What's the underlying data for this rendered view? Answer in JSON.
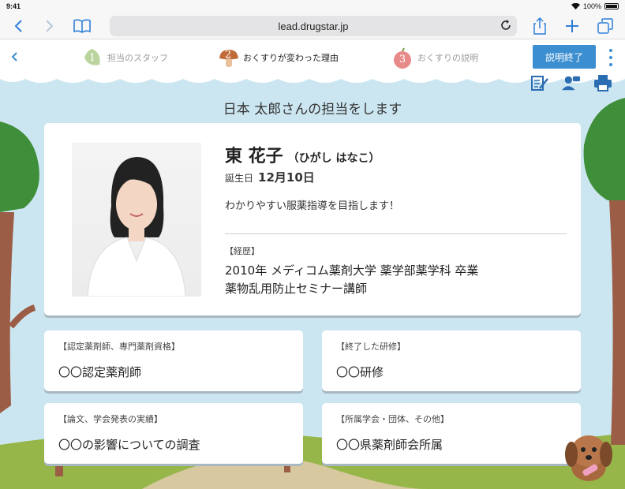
{
  "status": {
    "time": "9:41",
    "battery": "100%"
  },
  "browser": {
    "url": "lead.drugstar.jp"
  },
  "steps": [
    {
      "num": "1",
      "label": "担当のスタッフ"
    },
    {
      "num": "2",
      "label": "おくすりが変わった理由"
    },
    {
      "num": "3",
      "label": "おくすりの説明"
    }
  ],
  "end_button": "説明終了",
  "heading": "日本 太郎さんの担当をします",
  "profile": {
    "name": "東 花子",
    "kana": "（ひがし はなこ）",
    "birthday_label": "誕生日",
    "birthday": "12月10日",
    "message": "わかりやすい服薬指導を目指します！",
    "career_label": "【経歴】",
    "career_line1": "2010年 メディコム薬剤大学 薬学部薬学科 卒業",
    "career_line2": "薬物乱用防止セミナー講師"
  },
  "cards": [
    {
      "label": "【認定薬剤師、専門薬剤資格】",
      "value": "〇〇認定薬剤師"
    },
    {
      "label": "【終了した研修】",
      "value": "〇〇研修"
    },
    {
      "label": "【論文、学会発表の実績】",
      "value": "〇〇の影響についての調査"
    },
    {
      "label": "【所属学会・団体、その他】",
      "value": "〇〇県薬剤師会所属"
    }
  ],
  "colors": {
    "accent": "#3b8ed0",
    "sky": "#cce6f1",
    "grass": "#96b64a",
    "trunk": "#9b5d45"
  }
}
